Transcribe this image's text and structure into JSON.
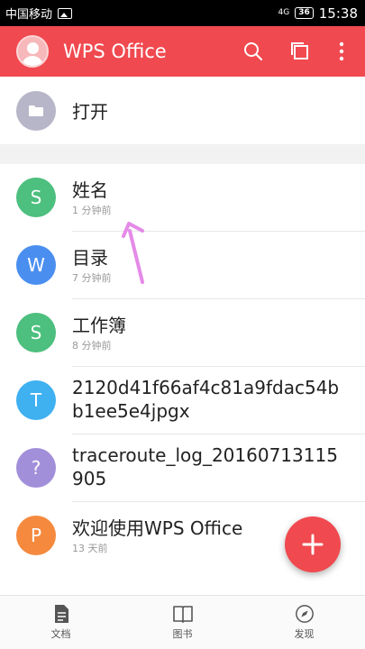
{
  "status_bar": {
    "carrier": "中国移动",
    "signal": "4G",
    "battery": "36",
    "time": "15:38"
  },
  "app_bar": {
    "title": "WPS Office",
    "accent_color": "#f0494f",
    "actions": [
      {
        "name": "search-icon"
      },
      {
        "name": "multi-window-icon"
      },
      {
        "name": "more-vert-icon"
      }
    ]
  },
  "open_row": {
    "label": "打开",
    "icon": "folder-icon"
  },
  "files": [
    {
      "letter": "S",
      "color": "#4dbf7e",
      "name": "姓名",
      "time": "1 分钟前"
    },
    {
      "letter": "W",
      "color": "#4a8ff0",
      "name": "目录",
      "time": "7 分钟前"
    },
    {
      "letter": "S",
      "color": "#4dbf7e",
      "name": "工作簿",
      "time": "8 分钟前"
    },
    {
      "letter": "T",
      "color": "#3fb0f0",
      "name": "2120d41f66af4c81a9fdac54bb1ee5e4jpgx",
      "time": ""
    },
    {
      "letter": "?",
      "color": "#a28fd9",
      "name": "traceroute_log_20160713115905",
      "time": ""
    },
    {
      "letter": "P",
      "color": "#f58a3f",
      "name": "欢迎使用WPS Office",
      "time": "13 天前"
    }
  ],
  "fab": {
    "icon": "plus-icon"
  },
  "bottom_nav": [
    {
      "label": "文档",
      "icon": "document-icon"
    },
    {
      "label": "图书",
      "icon": "book-icon"
    },
    {
      "label": "发现",
      "icon": "compass-icon"
    }
  ]
}
